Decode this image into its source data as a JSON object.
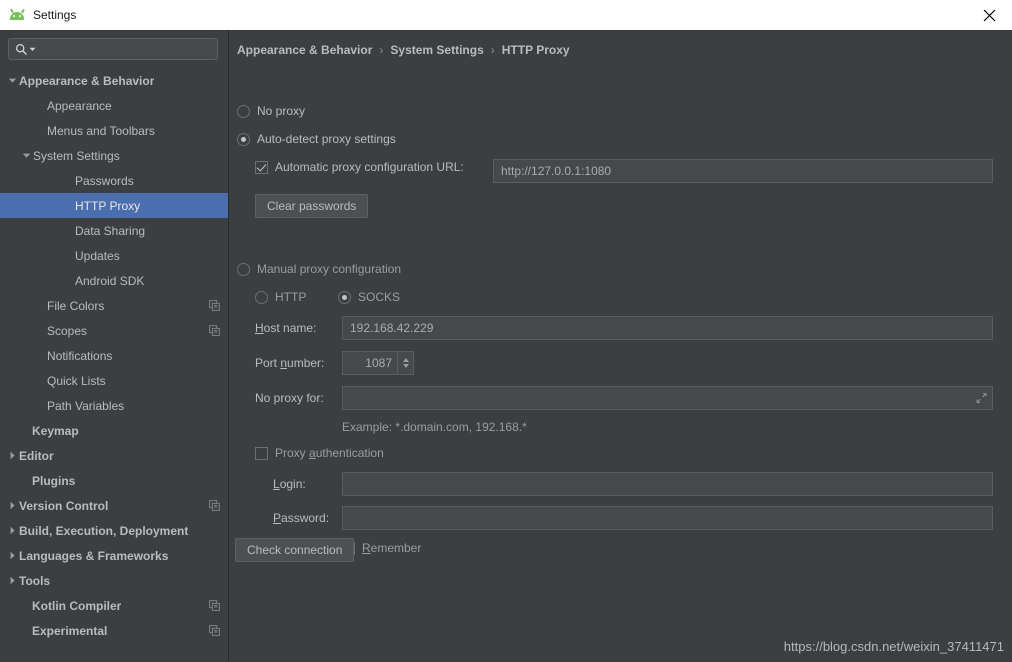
{
  "window": {
    "title": "Settings",
    "app_icon": "android-icon",
    "close_label": "✕"
  },
  "sidebar": {
    "search": {
      "placeholder": "",
      "value": "",
      "icon": "search-icon"
    },
    "items": [
      {
        "label": "Appearance & Behavior",
        "level": 0,
        "bold": true,
        "arrow": "down",
        "selected": false,
        "copy": false
      },
      {
        "label": "Appearance",
        "level": 1,
        "bold": false,
        "arrow": "none",
        "selected": false,
        "copy": false
      },
      {
        "label": "Menus and Toolbars",
        "level": 1,
        "bold": false,
        "arrow": "none",
        "selected": false,
        "copy": false
      },
      {
        "label": "System Settings",
        "level": 2,
        "bold": false,
        "arrow": "down",
        "selected": false,
        "copy": false
      },
      {
        "label": "Passwords",
        "level": 3,
        "bold": false,
        "arrow": "none",
        "selected": false,
        "copy": false
      },
      {
        "label": "HTTP Proxy",
        "level": 3,
        "bold": false,
        "arrow": "none",
        "selected": true,
        "copy": false
      },
      {
        "label": "Data Sharing",
        "level": 3,
        "bold": false,
        "arrow": "none",
        "selected": false,
        "copy": false
      },
      {
        "label": "Updates",
        "level": 3,
        "bold": false,
        "arrow": "none",
        "selected": false,
        "copy": false
      },
      {
        "label": "Android SDK",
        "level": 3,
        "bold": false,
        "arrow": "none",
        "selected": false,
        "copy": false
      },
      {
        "label": "File Colors",
        "level": 1,
        "bold": false,
        "arrow": "none",
        "selected": false,
        "copy": true
      },
      {
        "label": "Scopes",
        "level": 1,
        "bold": false,
        "arrow": "none",
        "selected": false,
        "copy": true
      },
      {
        "label": "Notifications",
        "level": 1,
        "bold": false,
        "arrow": "none",
        "selected": false,
        "copy": false
      },
      {
        "label": "Quick Lists",
        "level": 1,
        "bold": false,
        "arrow": "none",
        "selected": false,
        "copy": false
      },
      {
        "label": "Path Variables",
        "level": 1,
        "bold": false,
        "arrow": "none",
        "selected": false,
        "copy": false
      },
      {
        "label": "Keymap",
        "level": 0,
        "bold": true,
        "arrow": "none",
        "selected": false,
        "copy": false
      },
      {
        "label": "Editor",
        "level": 0,
        "bold": true,
        "arrow": "right",
        "selected": false,
        "copy": false
      },
      {
        "label": "Plugins",
        "level": 0,
        "bold": true,
        "arrow": "none",
        "selected": false,
        "copy": false
      },
      {
        "label": "Version Control",
        "level": 0,
        "bold": true,
        "arrow": "right",
        "selected": false,
        "copy": true
      },
      {
        "label": "Build, Execution, Deployment",
        "level": 0,
        "bold": true,
        "arrow": "right",
        "selected": false,
        "copy": false
      },
      {
        "label": "Languages & Frameworks",
        "level": 0,
        "bold": true,
        "arrow": "right",
        "selected": false,
        "copy": false
      },
      {
        "label": "Tools",
        "level": 0,
        "bold": true,
        "arrow": "right",
        "selected": false,
        "copy": false
      },
      {
        "label": "Kotlin Compiler",
        "level": 0,
        "bold": true,
        "arrow": "none",
        "selected": false,
        "copy": true
      },
      {
        "label": "Experimental",
        "level": 0,
        "bold": true,
        "arrow": "none",
        "selected": false,
        "copy": true
      }
    ]
  },
  "breadcrumb": {
    "part1": "Appearance & Behavior",
    "sep1": "›",
    "part2": "System Settings",
    "sep2": "›",
    "part3": "HTTP Proxy"
  },
  "proxy": {
    "no_proxy_label": "No proxy",
    "no_proxy_selected": false,
    "auto_detect_label": "Auto-detect proxy settings",
    "auto_detect_selected": true,
    "auto_config_label": "Automatic proxy configuration URL:",
    "auto_config_checked": true,
    "auto_config_url": "http://127.0.0.1:1080",
    "clear_passwords_label": "Clear passwords",
    "manual_label": "Manual proxy configuration",
    "manual_selected": false,
    "http_label": "HTTP",
    "http_selected": false,
    "socks_label": "SOCKS",
    "socks_selected": true,
    "host_label": "Host name:",
    "host_mnemonic": "H",
    "host_value": "192.168.42.229",
    "port_label": "Port number:",
    "port_mnemonic": "n",
    "port_value": "1087",
    "no_proxy_for_label": "No proxy for:",
    "no_proxy_for_value": "",
    "no_proxy_for_expand_icon": "expand-icon",
    "example_hint": "Example: *.domain.com, 192.168.*",
    "proxy_auth_label_pre": "Proxy ",
    "proxy_auth_mnemonic": "a",
    "proxy_auth_label_post": "uthentication",
    "proxy_auth_checked": false,
    "login_label": "Login:",
    "login_mnemonic": "L",
    "login_value": "",
    "password_label": "Password:",
    "password_mnemonic": "P",
    "password_value": "",
    "remember_label": "Remember",
    "remember_mnemonic": "R",
    "remember_checked": false,
    "check_connection_label": "Check connection"
  },
  "watermark": "https://blog.csdn.net/weixin_37411471",
  "colors": {
    "background": "#3c3f41",
    "selection": "#4b6eaf",
    "field": "#45494a",
    "titlebar": "#ffffff",
    "text": "#bbbbbb",
    "accent_green": "#77c159"
  }
}
